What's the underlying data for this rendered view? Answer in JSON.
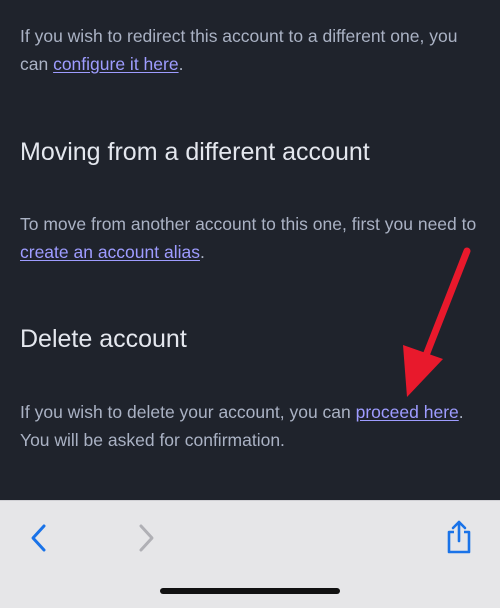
{
  "sections": {
    "redirect": {
      "text_before": "If you wish to redirect this account to a different one, you can ",
      "link": "configure it here",
      "text_after": "."
    },
    "moving": {
      "heading": "Moving from a different account",
      "text_before": "To move from another account to this one, first you need to ",
      "link": "create an account alias",
      "text_after": "."
    },
    "delete": {
      "heading": "Delete account",
      "text_before": "If you wish to delete your account, you can ",
      "link": "proceed here",
      "text_after": ". You will be asked for confirmation."
    }
  },
  "colors": {
    "background": "#1f232c",
    "body_text": "#aab2c4",
    "heading_text": "#e4e7ee",
    "link": "#9e9cff",
    "annotation_arrow": "#e8192c",
    "toolbar": "#e6e6e8",
    "toolbar_accent": "#1a73e8"
  },
  "toolbar": {
    "back_icon": "chevron-left-icon",
    "forward_icon": "chevron-right-icon",
    "share_icon": "share-icon",
    "forward_enabled": false
  }
}
